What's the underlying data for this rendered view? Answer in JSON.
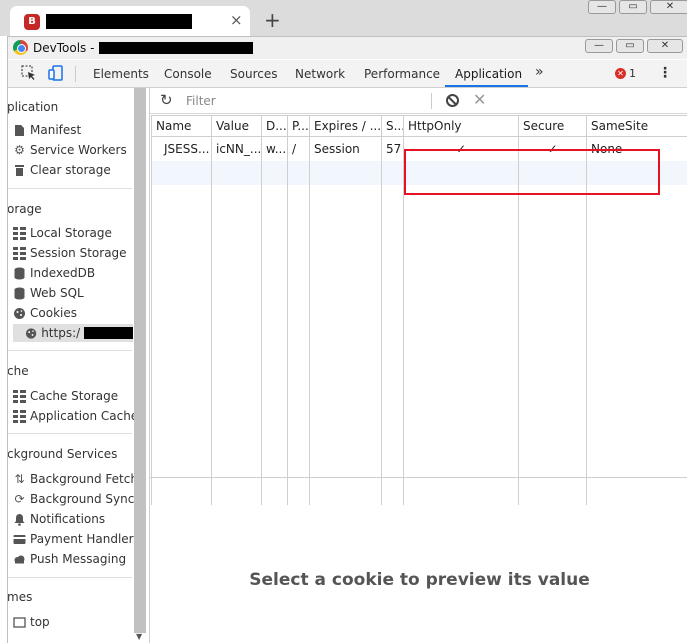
{
  "browser": {
    "favicon_letter": "B",
    "tab_close": "×",
    "new_tab": "+",
    "window_controls": [
      "—",
      "▭",
      "✕"
    ]
  },
  "devtools": {
    "title": "DevTools -",
    "window_controls": [
      "—",
      "▭",
      "✕"
    ],
    "tabs": [
      "Elements",
      "Console",
      "Sources",
      "Network",
      "Performance",
      "Application"
    ],
    "active_tab": "Application",
    "more_tabs": "»",
    "error_count": "1",
    "error_glyph": "✕",
    "menu_glyph": "⋮"
  },
  "sidebar": {
    "sections": [
      {
        "heading": "plication",
        "items": [
          "Manifest",
          "Service Workers",
          "Clear storage"
        ]
      },
      {
        "heading": "orage",
        "items": [
          "Local Storage",
          "Session Storage",
          "IndexedDB",
          "Web SQL",
          "Cookies"
        ]
      },
      {
        "heading": "che",
        "items": [
          "Cache Storage",
          "Application Cache"
        ]
      },
      {
        "heading": "ckground Services",
        "items": [
          "Background Fetch",
          "Background Sync",
          "Notifications",
          "Payment Handler",
          "Push Messaging"
        ]
      },
      {
        "heading": "mes",
        "items": [
          "top"
        ]
      }
    ],
    "cookie_origin_prefix": "https:/",
    "icons": {
      "manifest": "document-icon",
      "service_workers": "gear-icon",
      "clear_storage": "trash-icon",
      "local_storage": "grid-icon",
      "indexeddb": "database-icon",
      "cookies": "cookie-icon",
      "background_fetch": "up-down-arrows-icon",
      "background_sync": "sync-icon",
      "notifications": "bell-icon",
      "payment_handler": "card-icon",
      "frame": "frame-icon"
    }
  },
  "main": {
    "refresh_glyph": "↻",
    "filter_placeholder": "Filter",
    "delete_glyph": "✕",
    "columns": [
      "Name",
      "Value",
      "D...",
      "P...",
      "Expires / ...",
      "S...",
      "HttpOnly",
      "Secure",
      "SameSite"
    ],
    "rows": [
      {
        "name": "JSESS...",
        "value": "icNN_...",
        "domain": "w...",
        "path": "/",
        "expires": "Session",
        "size": "57",
        "httponly": "✓",
        "secure": "✓",
        "samesite": "None"
      }
    ],
    "preview_message": "Select a cookie to preview its value"
  },
  "colors": {
    "highlight_border": "#e81123",
    "active_tab_underline": "#1a73e8",
    "error_badge": "#d93025",
    "selected_row_bg": "#f2f7fd"
  }
}
